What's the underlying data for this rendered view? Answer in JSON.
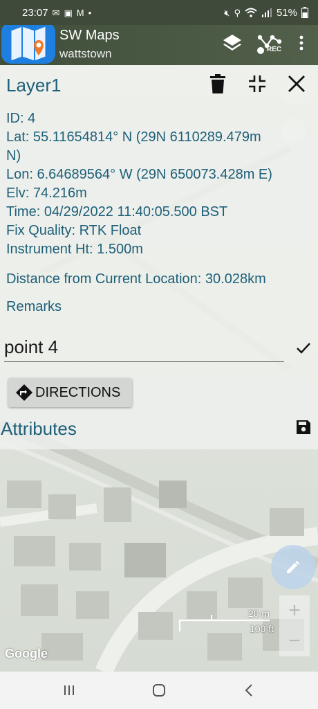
{
  "status_bar": {
    "time": "23:07",
    "battery": "51%",
    "left_icons": [
      "mail-icon",
      "image-icon",
      "gmail-icon",
      "dot-icon"
    ],
    "right_icons": [
      "mute-icon",
      "location-icon",
      "wifi-icon",
      "signal-icon",
      "battery-icon"
    ]
  },
  "app_bar": {
    "title": "SW Maps",
    "subtitle": "wattstown",
    "actions": [
      "layers-icon",
      "record-track-icon",
      "more-vert-icon"
    ],
    "rec_label": "REC"
  },
  "panel": {
    "layer_name": "Layer1",
    "actions": [
      "delete-icon",
      "collapse-icon",
      "close-icon"
    ],
    "id_line": "ID: 4",
    "lat_line1": "Lat: 55.11654814° N (29N 6110289.479m",
    "lat_line2": "N)",
    "lon_line": "Lon: 6.64689564° W (29N 650073.428m E)",
    "elv_line": "Elv: 74.216m",
    "time_line": "Time: 04/29/2022 11:40:05.500 BST",
    "fix_line": "Fix Quality: RTK Float",
    "instrument_line": "Instrument Ht: 1.500m",
    "distance_line": "Distance from Current Location: 30.028km",
    "remarks_label": "Remarks",
    "remarks_value": "point 4",
    "directions_label": "DIRECTIONS",
    "attributes_label": "Attributes"
  },
  "map": {
    "scale_metric": "20 m",
    "scale_imperial": "100 ft",
    "zoom_in": "+",
    "zoom_out": "−",
    "attribution": "Google"
  },
  "nav_bar": {
    "recents": "|||",
    "home": "○",
    "back": "‹"
  },
  "colors": {
    "accent_text": "#1d5f78",
    "app_logo": "#1f7fe0",
    "fab": "#bcd3ea"
  }
}
